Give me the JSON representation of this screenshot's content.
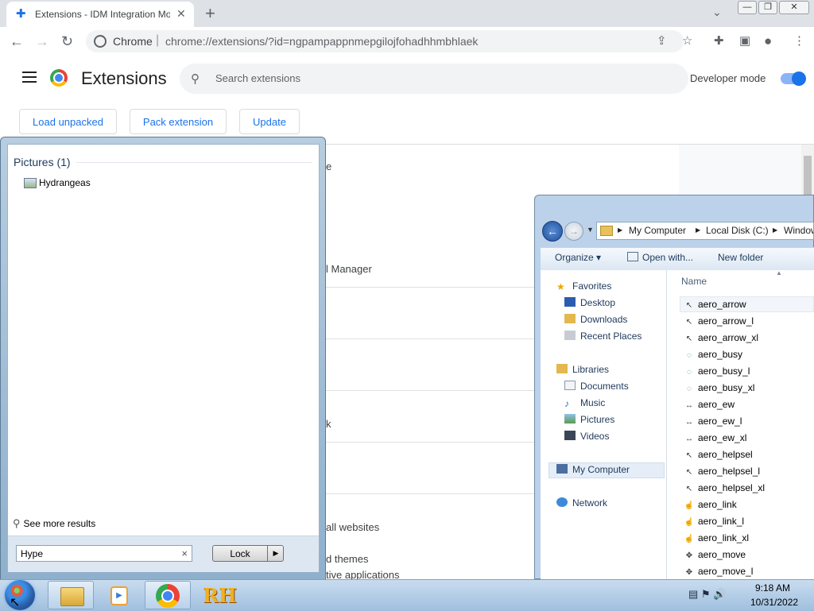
{
  "browser": {
    "tab_title": "Extensions - IDM Integration Mo",
    "tab_close": "✕",
    "new_tab": "+",
    "tab_search": "⌄",
    "win_min": "—",
    "win_max": "❐",
    "win_close": "✕",
    "back": "←",
    "forward": "→",
    "reload": "↻",
    "site_name": "Chrome",
    "url_sep": "|",
    "url": "chrome://extensions/?id=ngpampappnmepgilojfohadhhmbhlaek",
    "share_icon": "⇪",
    "star_icon": "☆",
    "puzzle_icon": "✚",
    "sidepanel_icon": "▣",
    "profile_icon": "●",
    "menu_icon": "⋮"
  },
  "extensions_page": {
    "title": "Extensions",
    "search_placeholder": "Search extensions",
    "search_icon": "⚲",
    "developer_mode_label": "Developer mode",
    "developer_mode_on": true,
    "accent": "#1a73e8",
    "buttons": {
      "load_unpacked": "Load unpacked",
      "pack_extension": "Pack extension",
      "update": "Update"
    },
    "card_fragments": {
      "f1": "e",
      "f2": "l Manager",
      "f3": "k",
      "f4": "all websites",
      "f5": "d themes",
      "f6": "tive applications"
    }
  },
  "start_menu": {
    "category": "Pictures (1)",
    "result_item": "Hydrangeas",
    "see_more": "See more results",
    "search_icon": "⚲",
    "search_value": "Hype",
    "clear_icon": "×",
    "lock_button": "Lock",
    "lock_arrow": "▶"
  },
  "explorer": {
    "back_icon": "←",
    "forward_icon": "→",
    "dropdown": "▼",
    "breadcrumb": {
      "c1": "My Computer",
      "c2": "Local Disk (C:)",
      "c3": "Windows",
      "tri": "▶"
    },
    "commands": {
      "organize": "Organize ▾",
      "open_with": "Open with...",
      "new_folder": "New folder"
    },
    "nav": {
      "favorites": "Favorites",
      "desktop": "Desktop",
      "downloads": "Downloads",
      "recent_places": "Recent Places",
      "libraries": "Libraries",
      "documents": "Documents",
      "music": "Music",
      "pictures": "Pictures",
      "videos": "Videos",
      "my_computer": "My Computer",
      "network": "Network"
    },
    "column_name": "Name",
    "sort_arrow": "▲",
    "files": {
      "f0": "aero_arrow",
      "f1": "aero_arrow_l",
      "f2": "aero_arrow_xl",
      "f3": "aero_busy",
      "f4": "aero_busy_l",
      "f5": "aero_busy_xl",
      "f6": "aero_ew",
      "f7": "aero_ew_l",
      "f8": "aero_ew_xl",
      "f9": "aero_helpsel",
      "f10": "aero_helpsel_l",
      "f11": "aero_helpsel_xl",
      "f12": "aero_link",
      "f13": "aero_link_l",
      "f14": "aero_link_xl",
      "f15": "aero_move",
      "f16": "aero_move_l"
    },
    "file_icons": {
      "arrow": "↖",
      "busy": "◌",
      "ew": "↔",
      "help": "↖",
      "link": "☝",
      "move": "✥"
    }
  },
  "taskbar": {
    "media_glyph": "▶",
    "rh_label": "RH",
    "tray_icons": "▤ ⚑ 🔊",
    "time": "9:18 AM",
    "date": "10/31/2022"
  }
}
